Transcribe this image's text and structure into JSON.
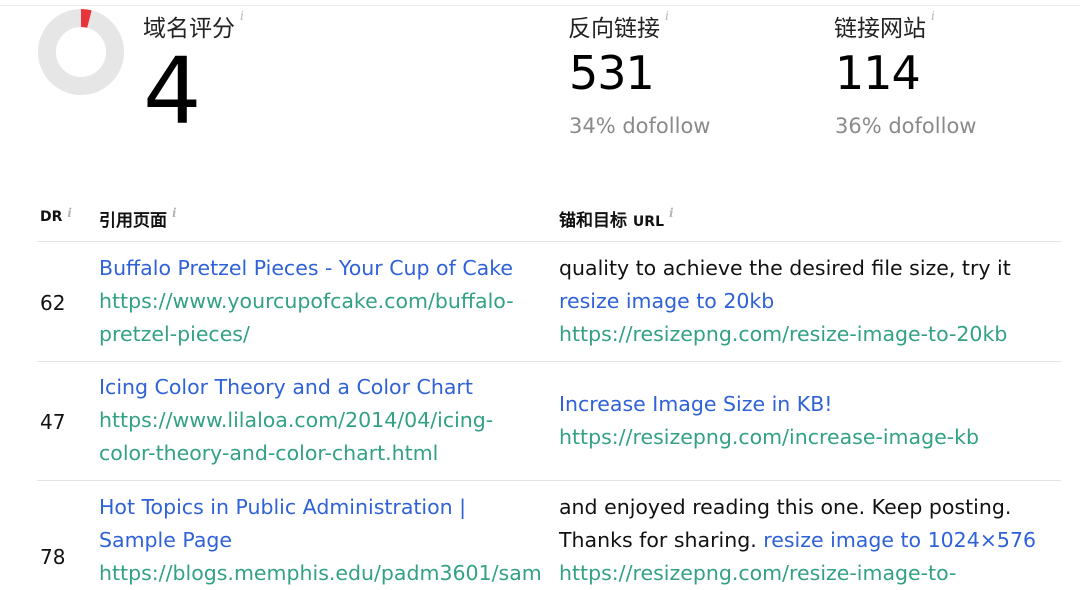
{
  "metrics": {
    "domain_rating": {
      "label": "域名评分",
      "value": "4",
      "score_fraction": 0.04
    },
    "backlinks": {
      "label": "反向链接",
      "value": "531",
      "sub": "34% dofollow"
    },
    "linking_sites": {
      "label": "链接网站",
      "value": "114",
      "sub": "36% dofollow"
    },
    "info_glyph": "i",
    "colors": {
      "donut_track": "#e6e6e6",
      "donut_fill": "#e8353b"
    }
  },
  "table": {
    "headers": {
      "dr": "DR",
      "referring_page": "引用页面",
      "anchor_target_cn": "锚和目标",
      "anchor_target_en": "URL"
    },
    "rows": [
      {
        "dr": "62",
        "title_lines": [
          "Buffalo Pretzel Pieces - Your Cup of Cake"
        ],
        "url_lines": [
          "https://www.yourcupofcake.com/buffalo-",
          "pretzel-pieces/"
        ],
        "anchor_context": "quality to achieve the desired file size, try it",
        "anchor_prefix": "",
        "anchor_text": "resize image to 20kb",
        "target_url_lines": [
          "https://resizepng.com/resize-image-to-20kb"
        ]
      },
      {
        "dr": "47",
        "title_lines": [
          "Icing Color Theory and a Color Chart"
        ],
        "url_lines": [
          "https://www.lilaloa.com/2014/04/icing-",
          "color-theory-and-color-chart.html"
        ],
        "anchor_context": "",
        "anchor_prefix": "",
        "anchor_text": "Increase Image Size in KB!",
        "target_url_lines": [
          "https://resizepng.com/increase-image-kb"
        ]
      },
      {
        "dr": "78",
        "title_lines": [
          "Hot Topics in Public Administration |",
          "Sample Page"
        ],
        "url_lines": [
          "https://blogs.memphis.edu/padm3601/sam"
        ],
        "anchor_context": "and enjoyed reading this one. Keep posting.",
        "anchor_prefix": "Thanks for sharing.",
        "anchor_text": "resize image to 1024×576",
        "target_url_lines": [
          "https://resizepng.com/resize-image-to-"
        ]
      }
    ]
  }
}
